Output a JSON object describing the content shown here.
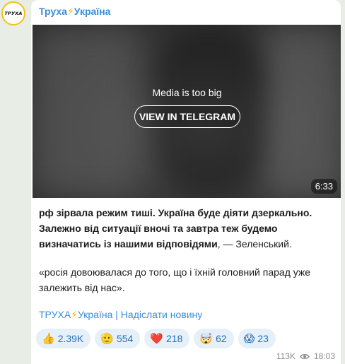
{
  "channel": {
    "name": "Труха",
    "bolt": "⚡",
    "suffix": "Україна",
    "avatar_text": "ТРУХА"
  },
  "media": {
    "note": "Media is too big",
    "button_label": "VIEW IN TELEGRAM",
    "duration": "6:33"
  },
  "message": {
    "bold_text": "рф зірвала режим тиші. Україна буде діяти дзеркально. Залежно від ситуації вночі та завтра теж будемо визначатись із нашими відповідями",
    "tail_text": ", — Зеленський.",
    "quote": "«росія довоювалася до того, що і їхній головний парад уже залежить від нас»."
  },
  "links": {
    "channel_link": "ТРУХА",
    "bolt": "⚡",
    "channel_suffix": "Україна",
    "separator": " | ",
    "submit_link": "Надіслати новину"
  },
  "reactions": [
    {
      "emoji": "👍",
      "count": "2.39K",
      "icon": "thumbs-up-icon"
    },
    {
      "emoji": "🫡",
      "count": "554",
      "icon": "saluting-face-icon"
    },
    {
      "emoji": "❤️",
      "count": "218",
      "icon": "heart-icon"
    },
    {
      "emoji": "🤯",
      "count": "62",
      "icon": "mind-blown-icon"
    },
    {
      "emoji": "😱",
      "count": "23",
      "icon": "screaming-face-icon"
    }
  ],
  "meta": {
    "views": "113K",
    "time": "18:03"
  }
}
